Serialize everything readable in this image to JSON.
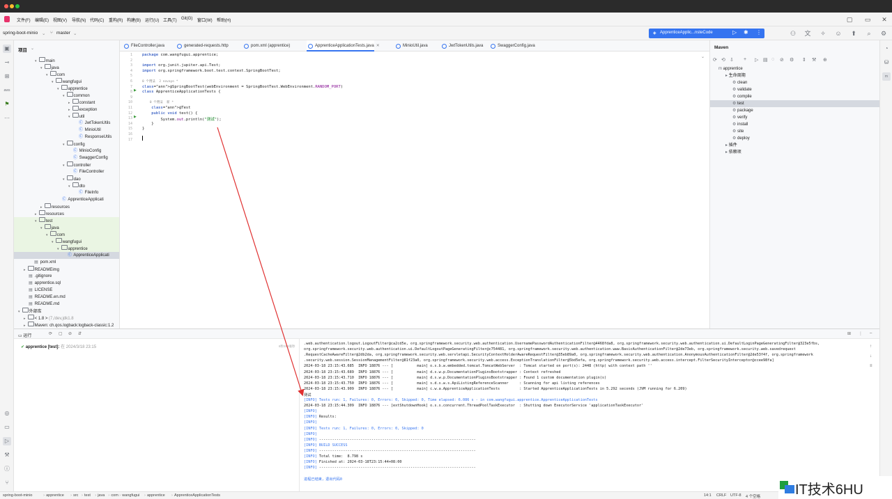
{
  "menu": [
    "文件(F)",
    "编辑(E)",
    "视图(V)",
    "导航(N)",
    "代码(C)",
    "重构(R)",
    "构建(B)",
    "运行(U)",
    "工具(T)",
    "Git(G)",
    "窗口(W)",
    "帮助(H)"
  ],
  "toolbar": {
    "project": "spring-boot-minio",
    "branch": "master",
    "run_config": "ApprenticeApplic...nsteCode"
  },
  "colors": {
    "accent": "#3574f0",
    "titlebar": "#2b2b2b",
    "selection": "#d5d9e0"
  },
  "project": {
    "title": "项目",
    "tree": [
      {
        "label": "main",
        "level": 3,
        "type": "folder",
        "open": true
      },
      {
        "label": "java",
        "level": 4,
        "type": "folder",
        "open": true
      },
      {
        "label": "com",
        "level": 5,
        "type": "folder",
        "open": true
      },
      {
        "label": "wangfugui",
        "level": 6,
        "type": "folder",
        "open": true
      },
      {
        "label": "apprentice",
        "level": 7,
        "type": "folder",
        "open": true
      },
      {
        "label": "common",
        "level": 8,
        "type": "folder",
        "open": true
      },
      {
        "label": "constant",
        "level": 9,
        "type": "folder",
        "open": false
      },
      {
        "label": "exception",
        "level": 9,
        "type": "folder",
        "open": false
      },
      {
        "label": "util",
        "level": 9,
        "type": "folder",
        "open": true
      },
      {
        "label": "JwtTokenUtils",
        "level": 10,
        "type": "class"
      },
      {
        "label": "MinioUtil",
        "level": 10,
        "type": "class"
      },
      {
        "label": "ResponseUtils",
        "level": 10,
        "type": "class"
      },
      {
        "label": "config",
        "level": 8,
        "type": "folder",
        "open": true
      },
      {
        "label": "MinioConfig",
        "level": 9,
        "type": "class"
      },
      {
        "label": "SwaggerConfig",
        "level": 9,
        "type": "class"
      },
      {
        "label": "controller",
        "level": 8,
        "type": "folder",
        "open": true
      },
      {
        "label": "FileController",
        "level": 9,
        "type": "class"
      },
      {
        "label": "dao",
        "level": 8,
        "type": "folder",
        "open": true
      },
      {
        "label": "dto",
        "level": 9,
        "type": "folder",
        "open": true
      },
      {
        "label": "FileInfo",
        "level": 10,
        "type": "class"
      },
      {
        "label": "ApprenticeApplicati",
        "level": 7,
        "type": "class"
      },
      {
        "label": "resources",
        "level": 4,
        "type": "folder",
        "open": false
      },
      {
        "label": "resources",
        "level": 3,
        "type": "folder",
        "open": false
      },
      {
        "label": "test",
        "level": 3,
        "type": "folder",
        "open": true,
        "green": true
      },
      {
        "label": "java",
        "level": 4,
        "type": "folder",
        "open": true,
        "green": true
      },
      {
        "label": "com",
        "level": 5,
        "type": "folder",
        "open": true,
        "green": true
      },
      {
        "label": "wangfugui",
        "level": 6,
        "type": "folder",
        "open": true,
        "green": true
      },
      {
        "label": "apprentice",
        "level": 7,
        "type": "folder",
        "open": true,
        "green": true
      },
      {
        "label": "ApprenticeApplicati",
        "level": 8,
        "type": "class",
        "selected": true
      },
      {
        "label": "pom.xml",
        "level": 2,
        "type": "file"
      },
      {
        "label": "READMEimg",
        "level": 1,
        "type": "folder",
        "open": false
      },
      {
        "label": ".gitignore",
        "level": 1,
        "type": "file"
      },
      {
        "label": "apprentice.sql",
        "level": 1,
        "type": "file"
      },
      {
        "label": "LICENSE",
        "level": 1,
        "type": "file"
      },
      {
        "label": "README.en.md",
        "level": 1,
        "type": "file"
      },
      {
        "label": "README.md",
        "level": 1,
        "type": "file"
      },
      {
        "label": "外部库",
        "level": 0,
        "type": "folder",
        "open": true
      },
      {
        "label": "< 1.8 >",
        "level": 1,
        "type": "folder",
        "open": false,
        "suffix": "(7,/dev,jdk1.8"
      },
      {
        "label": "Maven: ch.qos.logback:logback-classic:1.2",
        "level": 1,
        "type": "folder",
        "open": false
      }
    ]
  },
  "tabs": [
    {
      "label": "FileController.java",
      "active": false
    },
    {
      "label": "generated-requests.http",
      "active": false
    },
    {
      "label": "pom.xml (apprentice)",
      "active": false
    },
    {
      "label": "ApprenticeApplicationTests.java",
      "active": true
    },
    {
      "label": "MinioUtil.java",
      "active": false
    },
    {
      "label": "JwtTokenUtils.java",
      "active": false
    },
    {
      "label": "SwaggerConfig.java",
      "active": false
    }
  ],
  "editor": {
    "line_numbers": [
      "1",
      "2",
      "3",
      "4",
      "5",
      "6",
      "7",
      "8",
      "9",
      "10",
      "11",
      "12",
      "13",
      "14",
      "15",
      "16",
      "17"
    ],
    "lines": [
      {
        "t": "package com.wangfugui.apprentice;"
      },
      {
        "t": ""
      },
      {
        "t": "import org.junit.jupiter.api.Test;"
      },
      {
        "t": "import org.springframework.boot.test.context.SpringBootTest;"
      },
      {
        "t": ""
      },
      {
        "t": "0 个用法  2 novayo *",
        "hint": true
      },
      {
        "t": "@SpringBootTest(webEnvironment = SpringBootTest.WebEnvironment.RANDOM_PORT)"
      },
      {
        "t": "class ApprenticeApplicationTests {"
      },
      {
        "t": ""
      },
      {
        "t": "    0 个用法  新 *",
        "hint": true
      },
      {
        "t": "    @Test"
      },
      {
        "t": "    public void test() {"
      },
      {
        "t": "        System.out.println(\"测试\");"
      },
      {
        "t": "    }"
      },
      {
        "t": "}"
      },
      {
        "t": ""
      }
    ]
  },
  "maven": {
    "title": "Maven",
    "rows": [
      {
        "label": "apprentice",
        "level": 0
      },
      {
        "label": "生命周期",
        "level": 1
      },
      {
        "label": "clean",
        "level": 2
      },
      {
        "label": "validate",
        "level": 2
      },
      {
        "label": "compile",
        "level": 2
      },
      {
        "label": "test",
        "level": 2,
        "selected": true
      },
      {
        "label": "package",
        "level": 2
      },
      {
        "label": "verify",
        "level": 2
      },
      {
        "label": "install",
        "level": 2
      },
      {
        "label": "site",
        "level": 2
      },
      {
        "label": "deploy",
        "level": 2
      },
      {
        "label": "插件",
        "level": 1
      },
      {
        "label": "依赖项",
        "level": 1
      }
    ]
  },
  "run": {
    "title": "运行",
    "test_node": "apprentice [test]:",
    "test_time": "在 2024/3/18 23:15",
    "test_duration": "8秒283毫秒"
  },
  "console": [
    ".web.authentication.logout.LogoutFilter@ca2cd5e, org.springframework.security.web.authentication.UsernamePasswordAuthenticationFilter@4468fda8, org.springframework.security.web.authentication.ui.DefaultLoginPageGeneratingFilter@323e5fbs,",
    "org.springframework.security.web.authentication.ui.DefaultLogoutPageGeneratingFilter@c754481, org.springframework.security.web.authentication.www.BasicAuthenticationFilter@2de73eb, org.springframework.security.web.savedrequest",
    ".RequestCacheAwareFilter@2db2da, org.springframework.security.web.servletapi.SecurityContextHolderAwareRequestFilter@35eb89a0, org.springframework.security.web.authentication.AnonymousAuthenticationFilter@2de53f4f, org.springframework",
    ".security.web.session.SessionManagementFilter@81f23a0, org.springframework.security.web.access.ExceptionTranslationFilter@5bd5efa, org.springframework.security.web.access.intercept.FilterSecurityInterceptor@ccee98fa]",
    "2024-03-18 23:15:43.685  INFO 18876 --- [           main] o.s.b.w.embedded.tomcat.TomcatWebServer  : Tomcat started on port(s): 2448 (http) with context path ''",
    "2024-03-18 23:15:43.689  INFO 18876 --- [           main] d.s.w.p.DocumentationPluginsBootstrapper : Context refreshed",
    "2024-03-18 23:15:43.710  INFO 18876 --- [           main] d.s.w.p.DocumentationPluginsBootstrapper : Found 1 custom documentation plugin(s)",
    "2024-03-18 23:15:43.750  INFO 18876 --- [           main] s.d.s.w.s.ApiListingReferenceScanner     : Scanning for api listing references",
    "2024-03-18 23:15:43.909  INFO 18876 --- [           main] c.w.a.ApprenticeApplicationTests         : Started ApprenticeApplicationTests in 5.292 seconds (JVM running for 6.209)",
    "测试",
    "[INFO] Tests run: 1, Failures: 0, Errors: 0, Skipped: 0, Time elapsed: 6.086 s - in com.wangfugui.apprentice.ApprenticeApplicationTests",
    "2024-03-18 23:15:44.309  INFO 18876 --- [extShutdownHook] o.s.s.concurrent.ThreadPoolTaskExecutor  : Shutting down ExecutorService 'applicationTaskExecutor'",
    "[INFO]",
    "[INFO] Results:",
    "[INFO]",
    "[INFO] Tests run: 1, Failures: 0, Errors: 0, Skipped: 0",
    "[INFO]",
    "[INFO] ------------------------------------------------------------------------",
    "[INFO] BUILD SUCCESS",
    "[INFO] ------------------------------------------------------------------------",
    "[INFO] Total time:  8.798 s",
    "[INFO] Finished at: 2024-03-18T23:15:44+08:00",
    "[INFO] ------------------------------------------------------------------------",
    "",
    "进程已结束，退出代码0"
  ],
  "status": {
    "breadcrumb": [
      "spring-boot-minio",
      "apprentice",
      "src",
      "test",
      "java",
      "com",
      "wangfugui",
      "apprentice",
      "ApprenticeApplicationTests"
    ],
    "position": "14:1",
    "line_sep": "CRLF",
    "encoding": "UTF-8",
    "indent": "4 个空格"
  },
  "watermark": "IT技术6HU"
}
